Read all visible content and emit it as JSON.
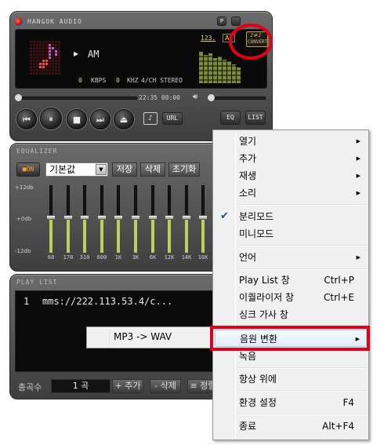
{
  "player": {
    "app_title": "HANGOK AUDIO",
    "title_btn_p": "P",
    "counter": "123.",
    "all_badge": "All",
    "convert_label": "CONVERT",
    "track_name": "AM",
    "kbps_value": "0",
    "kbps_unit": "KBPS",
    "khz_value": "0",
    "khz_unit": "KHZ",
    "channel": "4/CH STEREO",
    "time": "22:35 00:00",
    "url_label": "URL",
    "eq_label": "EQ",
    "list_label": "LIST"
  },
  "equalizer": {
    "title": "EQUALIZER",
    "on_label": "ON",
    "preset": "기본값",
    "save_label": "저장",
    "delete_label": "삭제",
    "reset_label": "초기화",
    "db_high": "+12db",
    "db_mid": "+0db",
    "db_low": "-12db",
    "bands": [
      "60",
      "170",
      "310",
      "600",
      "1K",
      "3K",
      "6K",
      "12K",
      "14K",
      "16K"
    ]
  },
  "playlist": {
    "title": "PLAY LIST",
    "row_num": "1",
    "row_url": "mms://222.113.53.4/c...",
    "total_label": "총곡수",
    "total_count": "1 곡",
    "add_label": "+ 추가",
    "delete_label": "- 삭제",
    "sort_label": "≡ 정렬"
  },
  "submenu": {
    "item": "MP3 -> WAV"
  },
  "menu": {
    "open": "열기",
    "add": "추가",
    "play": "재생",
    "sound": "소리",
    "split_mode": "분리모드",
    "mini_mode": "미니모드",
    "language": "언어",
    "playlist_window": "Play List 창",
    "playlist_shortcut": "Ctrl+P",
    "equalizer_window": "이퀄라이저 창",
    "equalizer_shortcut": "Ctrl+E",
    "lyrics_window": "싱크 가사 창",
    "convert": "음원 변환",
    "record": "녹음",
    "always_on_top": "항상 위에",
    "settings": "환경 설정",
    "settings_shortcut": "F4",
    "exit": "종료",
    "exit_shortcut": "Alt+F4"
  },
  "colors": {
    "highlight_box": "#e0001a",
    "eq_fill": "#b8d25a"
  }
}
